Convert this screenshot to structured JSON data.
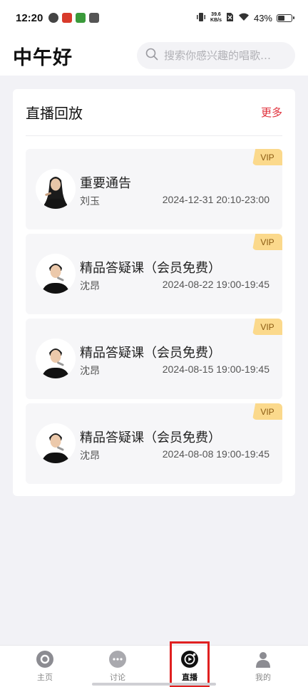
{
  "status_bar": {
    "time": "12:20",
    "net_speed_value": "39.6",
    "net_speed_unit": "KB/s",
    "battery": "43%"
  },
  "header": {
    "greeting": "中午好",
    "search_placeholder": "搜索你感兴趣的唱歌…"
  },
  "section": {
    "title": "直播回放",
    "more": "更多"
  },
  "items": [
    {
      "title": "重要通告",
      "host": "刘玉",
      "time": "2024-12-31 20:10-23:00",
      "badge": "VIP"
    },
    {
      "title": "精品答疑课（会员免费）",
      "host": "沈昂",
      "time": "2024-08-22 19:00-19:45",
      "badge": "VIP"
    },
    {
      "title": "精品答疑课（会员免费）",
      "host": "沈昂",
      "time": "2024-08-15 19:00-19:45",
      "badge": "VIP"
    },
    {
      "title": "精品答疑课（会员免费）",
      "host": "沈昂",
      "time": "2024-08-08 19:00-19:45",
      "badge": "VIP"
    }
  ],
  "nav": [
    {
      "label": "主页",
      "icon": "home-icon"
    },
    {
      "label": "讨论",
      "icon": "chat-icon"
    },
    {
      "label": "直播",
      "icon": "live-play-icon",
      "active": true
    },
    {
      "label": "我的",
      "icon": "person-icon"
    }
  ],
  "colors": {
    "accent": "#e0303b",
    "vip_badge": "#fbd98c",
    "highlight_box": "#e02020"
  }
}
